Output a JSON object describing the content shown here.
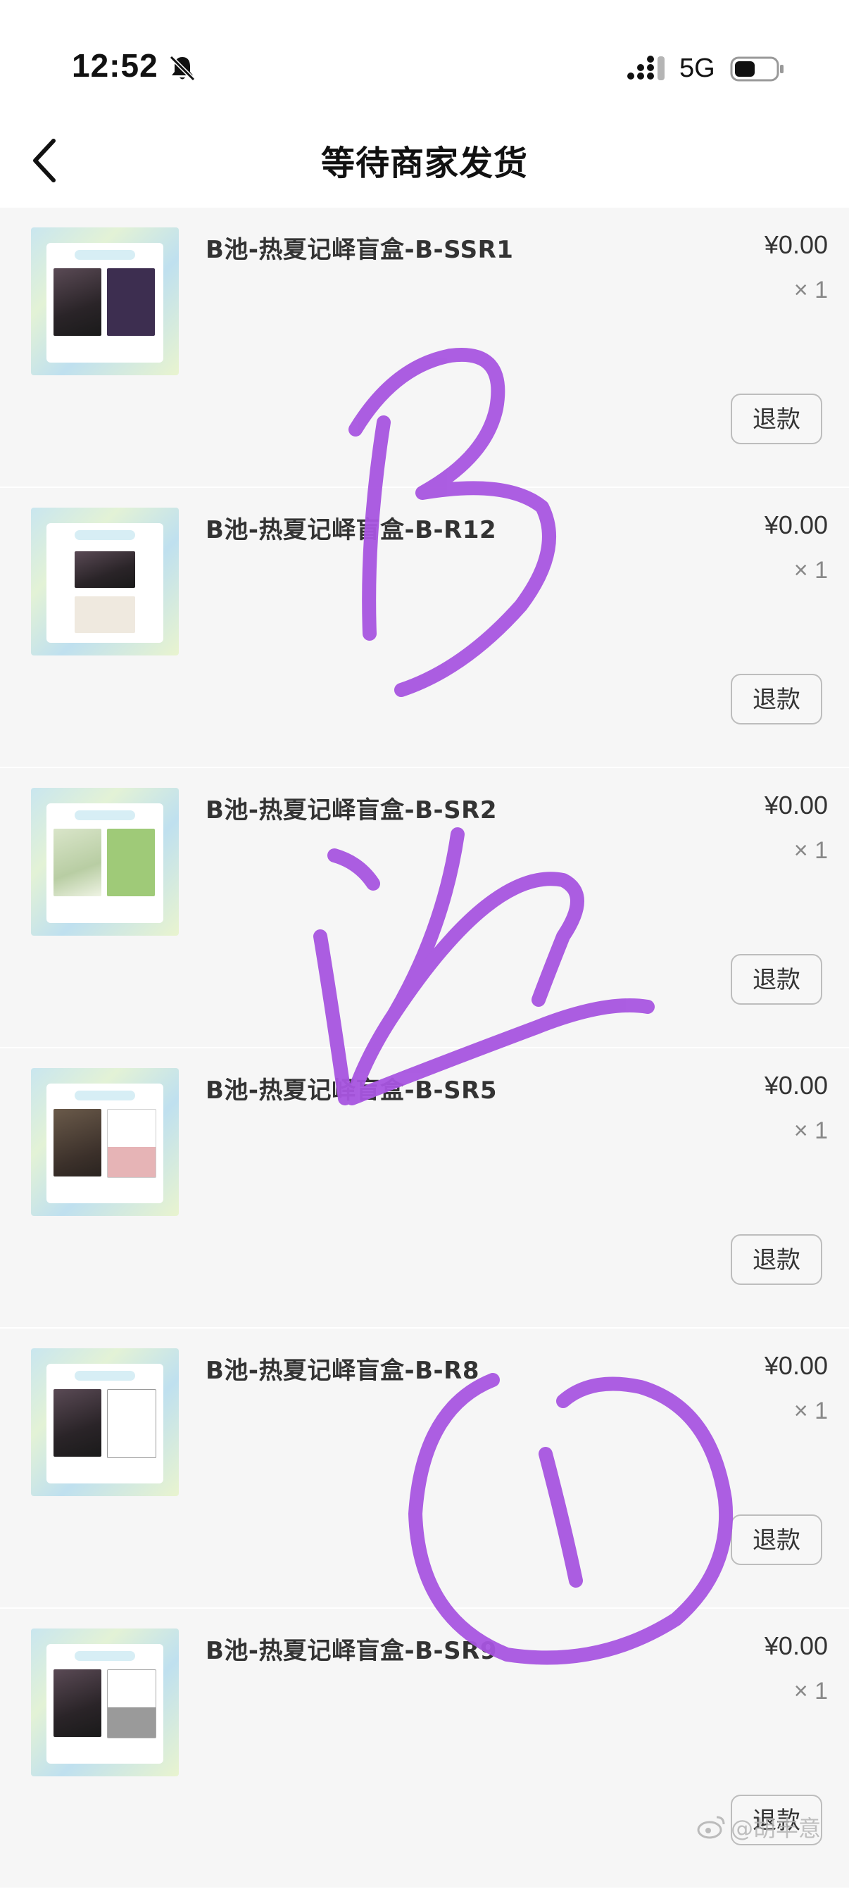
{
  "status_bar": {
    "time": "12:52",
    "network": "5G",
    "icons": [
      "bell-muted-icon",
      "cellular-signal-icon",
      "battery-icon"
    ]
  },
  "nav": {
    "title": "等待商家发货",
    "back_icon": "chevron-left-icon"
  },
  "orders": [
    {
      "title": "B池-热夏记峄盲盒-B-SSR1",
      "price": "¥0.00",
      "quantity": "× 1",
      "refund_label": "退款"
    },
    {
      "title": "B池-热夏记峄盲盒-B-R12",
      "price": "¥0.00",
      "quantity": "× 1",
      "refund_label": "退款"
    },
    {
      "title": "B池-热夏记峄盲盒-B-SR2",
      "price": "¥0.00",
      "quantity": "× 1",
      "refund_label": "退款"
    },
    {
      "title": "B池-热夏记峄盲盒-B-SR5",
      "price": "¥0.00",
      "quantity": "× 1",
      "refund_label": "退款"
    },
    {
      "title": "B池-热夏记峄盲盒-B-R8",
      "price": "¥0.00",
      "quantity": "× 1",
      "refund_label": "退款"
    },
    {
      "title": "B池-热夏记峄盲盒-B-SR9",
      "price": "¥0.00",
      "quantity": "× 1",
      "refund_label": "退款"
    }
  ],
  "annotation": {
    "text": "B池①",
    "color": "#a855e0"
  },
  "watermark": {
    "icon": "weibo-icon",
    "text": "@胡丰意"
  },
  "colors": {
    "background": "#f6f6f6",
    "surface": "#ffffff",
    "text_primary": "#333333",
    "text_secondary": "#888888",
    "annotation": "#a855e0"
  }
}
